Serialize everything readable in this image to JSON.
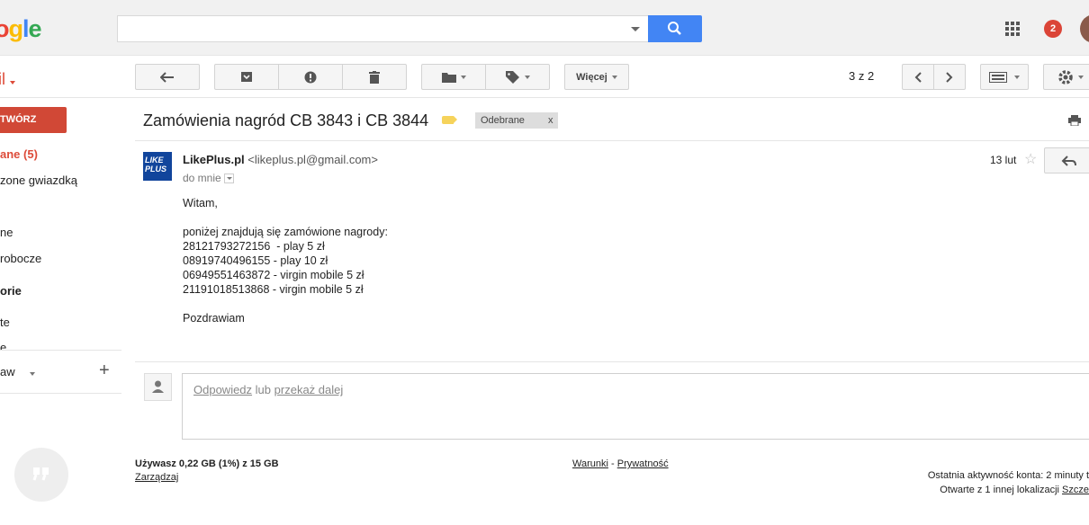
{
  "logo": {
    "text": "ogle"
  },
  "account": {
    "notification_count": "2"
  },
  "app_label": "il",
  "toolbar": {
    "more_label": "Więcej",
    "page_count": "3 z 2"
  },
  "sidebar": {
    "compose_label": "TWÓRZ",
    "items": [
      {
        "label": "ane (5)"
      },
      {
        "label": "zone gwiazdką"
      },
      {
        "label": "ne"
      },
      {
        "label": "robocze"
      },
      {
        "label": "orie"
      },
      {
        "label": "te"
      },
      {
        "label": "e"
      }
    ],
    "hangouts_user": "aw"
  },
  "message": {
    "subject": "Zamówienia nagród CB 3843 i CB 3844",
    "label_chip": "Odebrane",
    "label_chip_close": "x",
    "sender_logo_text": "LIKE PLUS",
    "sender_name": "LikePlus.pl",
    "sender_email": "<likeplus.pl@gmail.com>",
    "to": "do mnie",
    "date": "13 lut",
    "body_lines": [
      "Witam,",
      "",
      "poniżej znajdują się zamówione nagrody:",
      "28121793272156  - play 5 zł",
      "08919740496155 - play 10 zł",
      "06949551463872 - virgin mobile 5 zł",
      "21191018513868 - virgin mobile 5 zł",
      "",
      "Pozdrawiam"
    ]
  },
  "reply": {
    "reply_link": "Odpowiedz",
    "or_text": "lub",
    "forward_link": "przekaż dalej"
  },
  "footer": {
    "storage": "Używasz 0,22 GB (1%) z 15 GB",
    "manage": "Zarządzaj",
    "terms": "Warunki",
    "separator": "-",
    "privacy": "Prywatność",
    "activity": "Ostatnia aktywność konta: 2 minuty t",
    "open_elsewhere": "Otwarte z 1 innej lokalizacji",
    "details": "Szcze"
  }
}
